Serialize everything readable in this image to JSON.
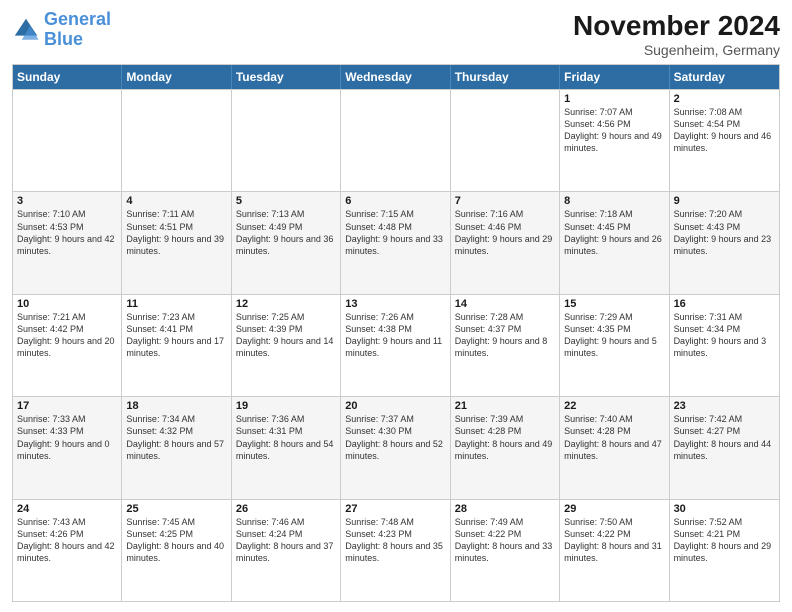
{
  "logo": {
    "line1": "General",
    "line2": "Blue"
  },
  "title": "November 2024",
  "subtitle": "Sugenheim, Germany",
  "headers": [
    "Sunday",
    "Monday",
    "Tuesday",
    "Wednesday",
    "Thursday",
    "Friday",
    "Saturday"
  ],
  "rows": [
    [
      {
        "day": "",
        "sunrise": "",
        "sunset": "",
        "daylight": ""
      },
      {
        "day": "",
        "sunrise": "",
        "sunset": "",
        "daylight": ""
      },
      {
        "day": "",
        "sunrise": "",
        "sunset": "",
        "daylight": ""
      },
      {
        "day": "",
        "sunrise": "",
        "sunset": "",
        "daylight": ""
      },
      {
        "day": "",
        "sunrise": "",
        "sunset": "",
        "daylight": ""
      },
      {
        "day": "1",
        "sunrise": "Sunrise: 7:07 AM",
        "sunset": "Sunset: 4:56 PM",
        "daylight": "Daylight: 9 hours and 49 minutes."
      },
      {
        "day": "2",
        "sunrise": "Sunrise: 7:08 AM",
        "sunset": "Sunset: 4:54 PM",
        "daylight": "Daylight: 9 hours and 46 minutes."
      }
    ],
    [
      {
        "day": "3",
        "sunrise": "Sunrise: 7:10 AM",
        "sunset": "Sunset: 4:53 PM",
        "daylight": "Daylight: 9 hours and 42 minutes."
      },
      {
        "day": "4",
        "sunrise": "Sunrise: 7:11 AM",
        "sunset": "Sunset: 4:51 PM",
        "daylight": "Daylight: 9 hours and 39 minutes."
      },
      {
        "day": "5",
        "sunrise": "Sunrise: 7:13 AM",
        "sunset": "Sunset: 4:49 PM",
        "daylight": "Daylight: 9 hours and 36 minutes."
      },
      {
        "day": "6",
        "sunrise": "Sunrise: 7:15 AM",
        "sunset": "Sunset: 4:48 PM",
        "daylight": "Daylight: 9 hours and 33 minutes."
      },
      {
        "day": "7",
        "sunrise": "Sunrise: 7:16 AM",
        "sunset": "Sunset: 4:46 PM",
        "daylight": "Daylight: 9 hours and 29 minutes."
      },
      {
        "day": "8",
        "sunrise": "Sunrise: 7:18 AM",
        "sunset": "Sunset: 4:45 PM",
        "daylight": "Daylight: 9 hours and 26 minutes."
      },
      {
        "day": "9",
        "sunrise": "Sunrise: 7:20 AM",
        "sunset": "Sunset: 4:43 PM",
        "daylight": "Daylight: 9 hours and 23 minutes."
      }
    ],
    [
      {
        "day": "10",
        "sunrise": "Sunrise: 7:21 AM",
        "sunset": "Sunset: 4:42 PM",
        "daylight": "Daylight: 9 hours and 20 minutes."
      },
      {
        "day": "11",
        "sunrise": "Sunrise: 7:23 AM",
        "sunset": "Sunset: 4:41 PM",
        "daylight": "Daylight: 9 hours and 17 minutes."
      },
      {
        "day": "12",
        "sunrise": "Sunrise: 7:25 AM",
        "sunset": "Sunset: 4:39 PM",
        "daylight": "Daylight: 9 hours and 14 minutes."
      },
      {
        "day": "13",
        "sunrise": "Sunrise: 7:26 AM",
        "sunset": "Sunset: 4:38 PM",
        "daylight": "Daylight: 9 hours and 11 minutes."
      },
      {
        "day": "14",
        "sunrise": "Sunrise: 7:28 AM",
        "sunset": "Sunset: 4:37 PM",
        "daylight": "Daylight: 9 hours and 8 minutes."
      },
      {
        "day": "15",
        "sunrise": "Sunrise: 7:29 AM",
        "sunset": "Sunset: 4:35 PM",
        "daylight": "Daylight: 9 hours and 5 minutes."
      },
      {
        "day": "16",
        "sunrise": "Sunrise: 7:31 AM",
        "sunset": "Sunset: 4:34 PM",
        "daylight": "Daylight: 9 hours and 3 minutes."
      }
    ],
    [
      {
        "day": "17",
        "sunrise": "Sunrise: 7:33 AM",
        "sunset": "Sunset: 4:33 PM",
        "daylight": "Daylight: 9 hours and 0 minutes."
      },
      {
        "day": "18",
        "sunrise": "Sunrise: 7:34 AM",
        "sunset": "Sunset: 4:32 PM",
        "daylight": "Daylight: 8 hours and 57 minutes."
      },
      {
        "day": "19",
        "sunrise": "Sunrise: 7:36 AM",
        "sunset": "Sunset: 4:31 PM",
        "daylight": "Daylight: 8 hours and 54 minutes."
      },
      {
        "day": "20",
        "sunrise": "Sunrise: 7:37 AM",
        "sunset": "Sunset: 4:30 PM",
        "daylight": "Daylight: 8 hours and 52 minutes."
      },
      {
        "day": "21",
        "sunrise": "Sunrise: 7:39 AM",
        "sunset": "Sunset: 4:28 PM",
        "daylight": "Daylight: 8 hours and 49 minutes."
      },
      {
        "day": "22",
        "sunrise": "Sunrise: 7:40 AM",
        "sunset": "Sunset: 4:28 PM",
        "daylight": "Daylight: 8 hours and 47 minutes."
      },
      {
        "day": "23",
        "sunrise": "Sunrise: 7:42 AM",
        "sunset": "Sunset: 4:27 PM",
        "daylight": "Daylight: 8 hours and 44 minutes."
      }
    ],
    [
      {
        "day": "24",
        "sunrise": "Sunrise: 7:43 AM",
        "sunset": "Sunset: 4:26 PM",
        "daylight": "Daylight: 8 hours and 42 minutes."
      },
      {
        "day": "25",
        "sunrise": "Sunrise: 7:45 AM",
        "sunset": "Sunset: 4:25 PM",
        "daylight": "Daylight: 8 hours and 40 minutes."
      },
      {
        "day": "26",
        "sunrise": "Sunrise: 7:46 AM",
        "sunset": "Sunset: 4:24 PM",
        "daylight": "Daylight: 8 hours and 37 minutes."
      },
      {
        "day": "27",
        "sunrise": "Sunrise: 7:48 AM",
        "sunset": "Sunset: 4:23 PM",
        "daylight": "Daylight: 8 hours and 35 minutes."
      },
      {
        "day": "28",
        "sunrise": "Sunrise: 7:49 AM",
        "sunset": "Sunset: 4:22 PM",
        "daylight": "Daylight: 8 hours and 33 minutes."
      },
      {
        "day": "29",
        "sunrise": "Sunrise: 7:50 AM",
        "sunset": "Sunset: 4:22 PM",
        "daylight": "Daylight: 8 hours and 31 minutes."
      },
      {
        "day": "30",
        "sunrise": "Sunrise: 7:52 AM",
        "sunset": "Sunset: 4:21 PM",
        "daylight": "Daylight: 8 hours and 29 minutes."
      }
    ]
  ]
}
